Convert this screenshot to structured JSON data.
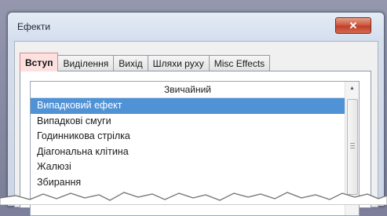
{
  "window": {
    "title": "Ефекти",
    "close_label": "✕"
  },
  "tabs": [
    {
      "label": "Вступ",
      "active": true
    },
    {
      "label": "Виділення",
      "active": false
    },
    {
      "label": "Вихід",
      "active": false
    },
    {
      "label": "Шляхи руху",
      "active": false
    },
    {
      "label": "Misc Effects",
      "active": false
    }
  ],
  "list": {
    "header": "Звичайний",
    "items": [
      "Випадковий ефект",
      "Випадкові смуги",
      "Годинникова стрілка",
      "Діагональна клітина",
      "Жалюзі",
      "Збирання"
    ],
    "selected_index": 0
  },
  "scrollbar": {
    "up_arrow": "▲"
  },
  "colors": {
    "selection": "#4f92d6",
    "active_tab": "#fde0e0",
    "close_button": "#c94a33"
  }
}
